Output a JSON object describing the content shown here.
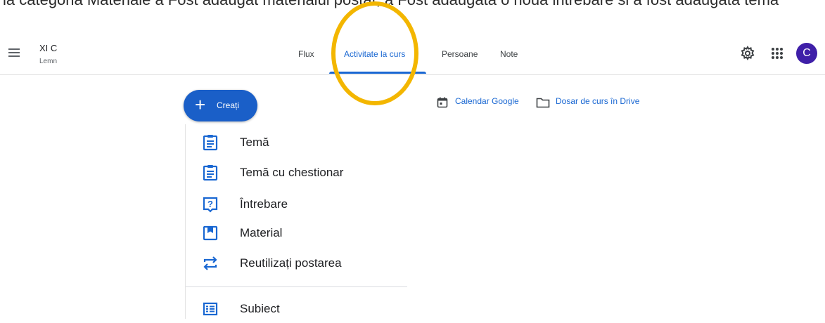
{
  "top_strip_text": "la categoria Materiale a Fost adaugat materialul postat, a Fost adaugata o noua intrebare si a fost adaugata tema",
  "course": {
    "title": "XI C",
    "subtitle": "Lemn"
  },
  "tabs": [
    {
      "label": "Flux",
      "active": false
    },
    {
      "label": "Activitate la curs",
      "active": true
    },
    {
      "label": "Persoane",
      "active": false
    },
    {
      "label": "Note",
      "active": false
    }
  ],
  "header_icons": [
    "gear-icon",
    "apps-grid-icon"
  ],
  "avatar_letter": "C",
  "create_button": {
    "label": "Creați",
    "icon": "plus-icon"
  },
  "toolbar_links": [
    {
      "label": "Calendar Google",
      "icon": "calendar-icon"
    },
    {
      "label": "Dosar de curs în Drive",
      "icon": "folder-icon"
    }
  ],
  "menu": [
    {
      "label": "Temă",
      "icon": "assignment-icon"
    },
    {
      "label": "Temă cu chestionar",
      "icon": "quiz-assignment-icon"
    },
    {
      "label": "Întrebare",
      "icon": "question-icon"
    },
    {
      "label": "Material",
      "icon": "material-icon"
    },
    {
      "label": "Reutilizați postarea",
      "icon": "reuse-icon"
    },
    {
      "label": "Subiect",
      "icon": "topic-icon"
    }
  ],
  "colors": {
    "accent": "#1967d2",
    "create_button": "#1a5fc8",
    "avatar": "#3f1fa8",
    "highlight_ring": "#f3b600"
  }
}
